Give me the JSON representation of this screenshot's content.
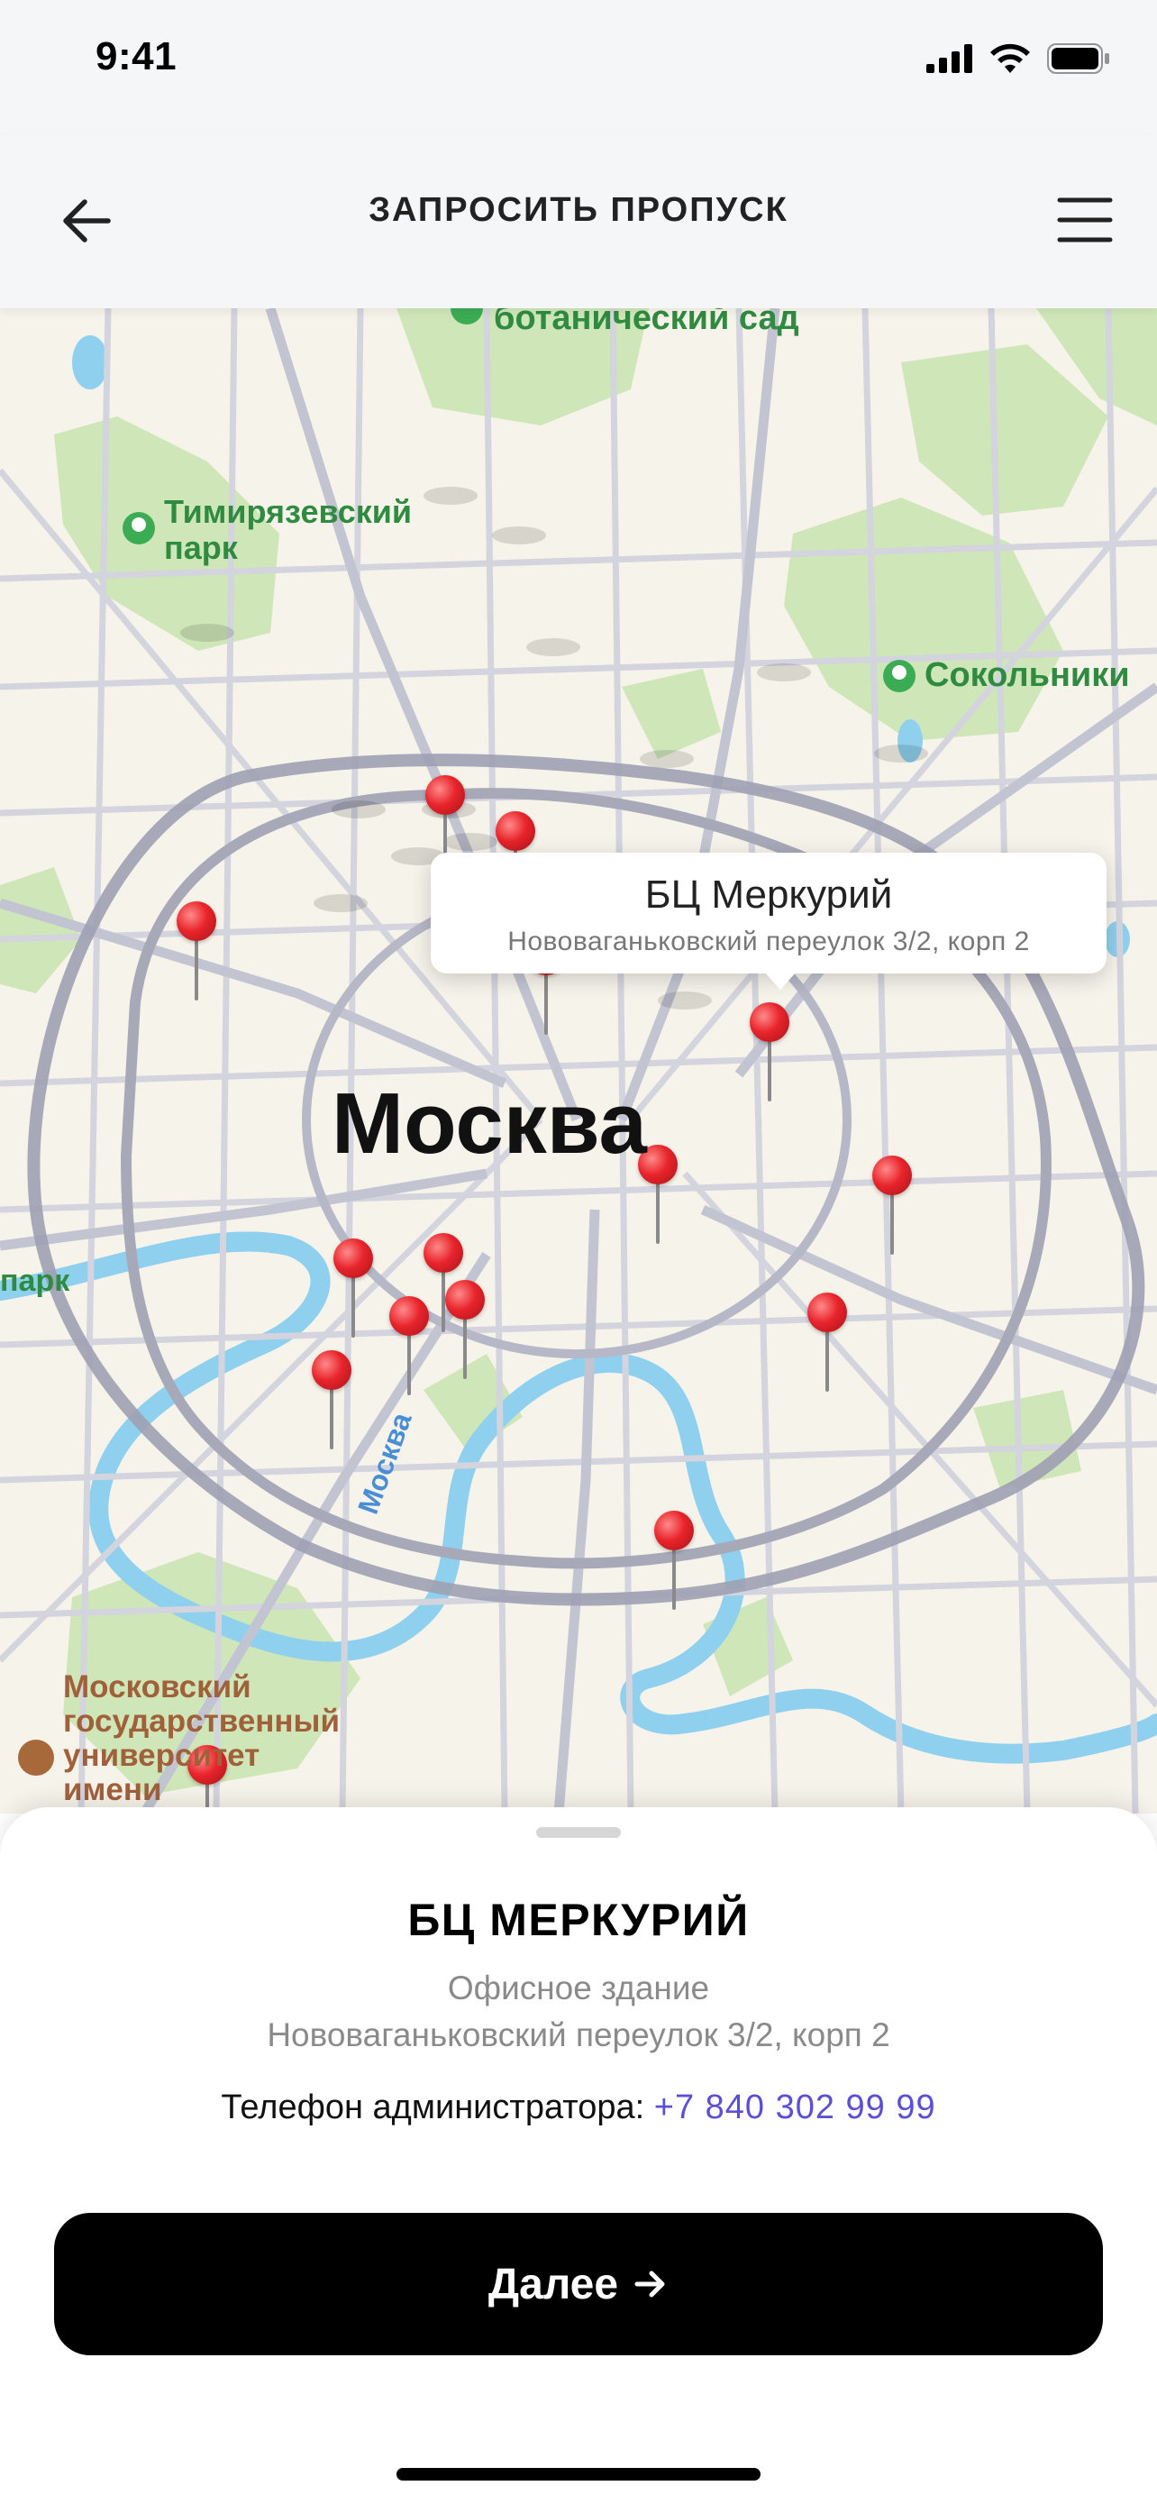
{
  "status_bar": {
    "time": "9:41"
  },
  "nav": {
    "title": "ЗАПРОСИТЬ ПРОПУСК"
  },
  "map": {
    "labels": {
      "garden": "ботанический сад",
      "park1": "Тимирязевский",
      "park2": "парк",
      "sokolniki": "Сокольники",
      "city": "Москва",
      "river": "Москва",
      "park_edge": "парк",
      "mgu1": "Московский",
      "mgu2": "государственный",
      "mgu3": "университет",
      "mgu4": "имени"
    },
    "callout": {
      "title": "БЦ Меркурий",
      "address": "Нововаганьковский переулок 3/2, корп 2"
    },
    "colors": {
      "park": "#cfe6b8",
      "road": "#c9cad6",
      "ring": "#a7a9b8",
      "water": "#8fd0ee",
      "pin": "#e8242b"
    }
  },
  "sheet": {
    "title": "БЦ МЕРКУРИЙ",
    "type": "Офисное здание",
    "address": "Нововаганьковский переулок 3/2, корп 2",
    "phone_label": "Телефон администратора:",
    "phone": "+7 840 302 99 99",
    "next_label": "Далее"
  }
}
